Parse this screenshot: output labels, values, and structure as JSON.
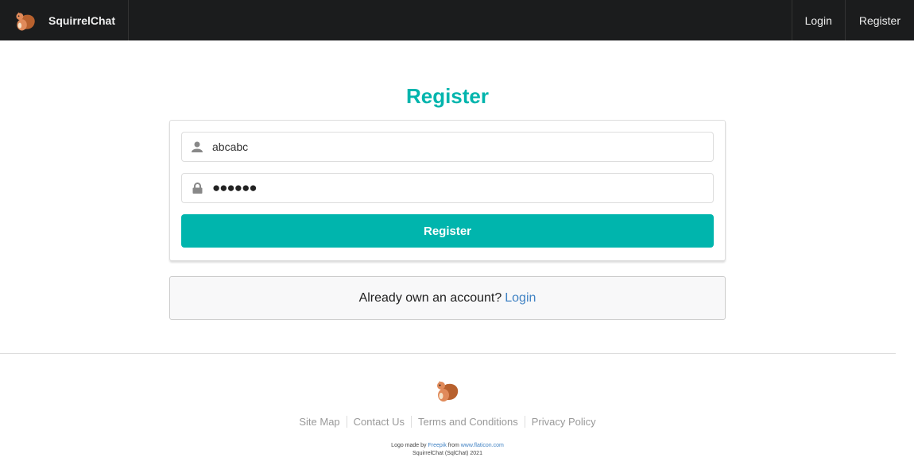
{
  "nav": {
    "brand": "SquirrelChat",
    "login": "Login",
    "register": "Register"
  },
  "form": {
    "title": "Register",
    "username_value": "abcabc",
    "password_masked": "●●●●●●",
    "submit": "Register"
  },
  "message": {
    "text": "Already own an account?",
    "link": "Login"
  },
  "footer": {
    "links": [
      "Site Map",
      "Contact Us",
      "Terms and Conditions",
      "Privacy Policy"
    ],
    "credit_prefix": "Logo made by",
    "credit_author": "Freepik",
    "credit_mid": "from",
    "credit_site": "www.flaticon.com",
    "copyright": "SquirrelChat (SqlChat) 2021"
  },
  "colors": {
    "accent": "#00b5ad",
    "link": "#4183c4",
    "navbar": "#1b1c1d"
  }
}
